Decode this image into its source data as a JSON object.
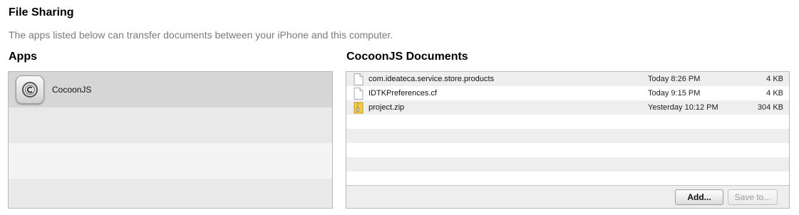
{
  "header": {
    "title": "File Sharing",
    "description": "The apps listed below can transfer documents between your iPhone and this computer."
  },
  "apps": {
    "title": "Apps",
    "items": [
      {
        "name": "CocoonJS",
        "icon": "cocoonjs-app-icon",
        "selected": true
      }
    ]
  },
  "documents": {
    "title": "CocoonJS Documents",
    "files": [
      {
        "name": "com.ideateca.service.store.products",
        "date": "Today 8:26 PM",
        "size": "4 KB",
        "icon": "document-icon"
      },
      {
        "name": "IDTKPreferences.cf",
        "date": "Today 9:15 PM",
        "size": "4 KB",
        "icon": "document-icon"
      },
      {
        "name": "project.zip",
        "date": "Yesterday 10:12 PM",
        "size": "304 KB",
        "icon": "zip-archive-icon"
      }
    ],
    "add_label": "Add...",
    "saveto_label": "Save to..."
  }
}
